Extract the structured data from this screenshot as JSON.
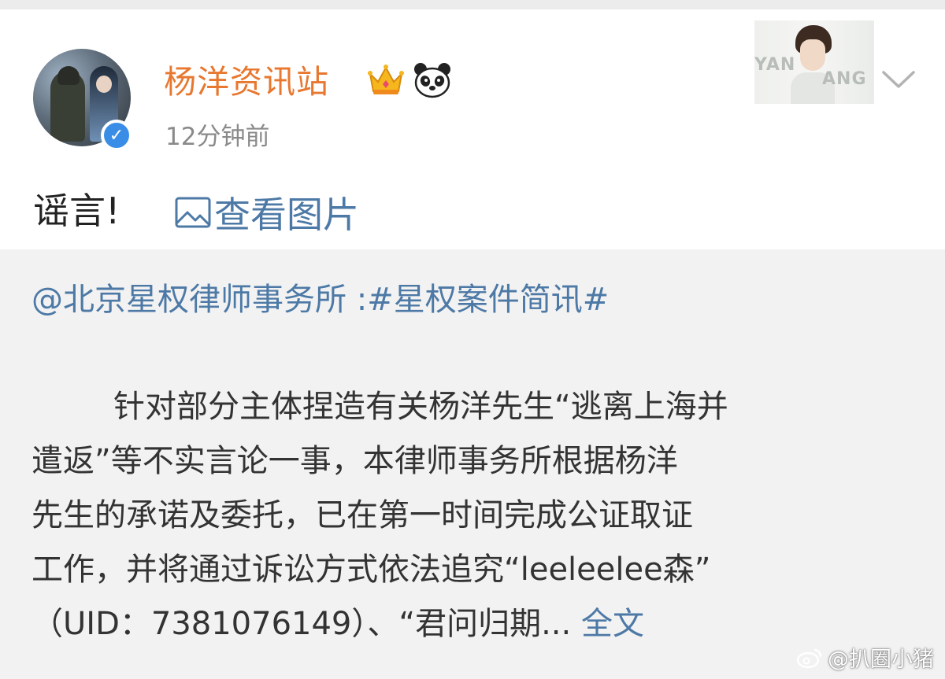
{
  "post": {
    "username": "杨洋资讯站",
    "timestamp": "12分钟前",
    "text": "谣言!",
    "view_image_label": "查看图片",
    "card_image_text_left": "YAN",
    "card_image_text_right": "ANG"
  },
  "repost": {
    "source_line": "@北京星权律师事务所 :#星权案件简讯#",
    "body_lines": [
      "针对部分主体捏造有关杨洋先生“逃离上海并",
      "遣返”等不实言论一事，本律师事务所根据杨洋",
      "先生的承诺及委托，已在第一时间完成公证取证",
      "工作，并将通过诉讼方式依法追究“leeleelee森”",
      "（UID：7381076149）、“君问归期... "
    ],
    "full_text_label": "全文"
  },
  "watermark": {
    "text": "@扒圈小猪"
  },
  "colors": {
    "username": "#e8772f",
    "link": "#4d79a6",
    "verified": "#3a8de6",
    "repost_bg": "#f2f2f2"
  },
  "icons": {
    "verified": "verified-badge-icon",
    "crown": "crown-icon",
    "panda": "panda-icon",
    "chevron": "chevron-down-icon",
    "image": "image-icon",
    "weibo": "weibo-logo-icon"
  }
}
